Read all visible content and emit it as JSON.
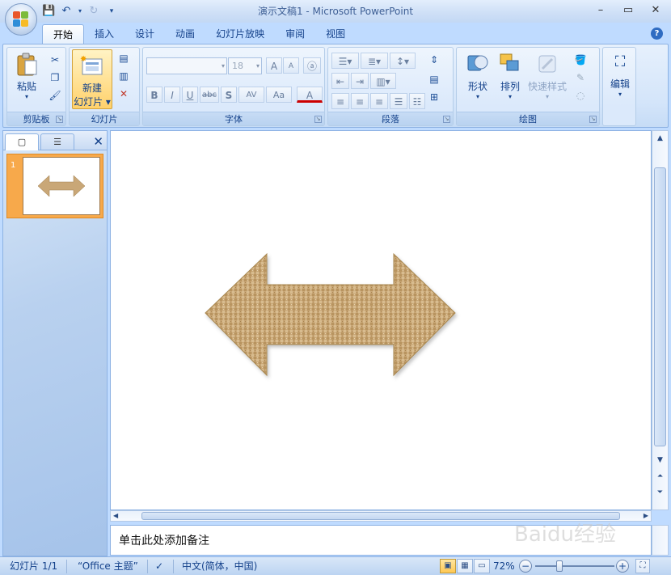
{
  "window": {
    "title": "演示文稿1 - Microsoft PowerPoint",
    "minimize": "–",
    "restore": "▭",
    "close": "✕"
  },
  "quick_access": {
    "save_icon": "save-icon",
    "undo_icon": "undo-icon",
    "redo_icon": "redo-icon",
    "customize_icon": "customize-icon"
  },
  "tabs": [
    {
      "label": "开始",
      "active": true
    },
    {
      "label": "插入"
    },
    {
      "label": "设计"
    },
    {
      "label": "动画"
    },
    {
      "label": "幻灯片放映"
    },
    {
      "label": "审阅"
    },
    {
      "label": "视图"
    }
  ],
  "ribbon": {
    "clipboard": {
      "label": "剪贴板",
      "paste": "粘贴"
    },
    "slides": {
      "label": "幻灯片",
      "new_slide_line1": "新建",
      "new_slide_line2": "幻灯片"
    },
    "font": {
      "label": "字体",
      "font_name": "",
      "font_size": "18",
      "bold": "B",
      "italic": "I",
      "underline": "U",
      "strike": "abc",
      "shadow": "S",
      "spacing": "AV",
      "case": "Aa",
      "color": "A",
      "grow": "A",
      "shrink": "A"
    },
    "paragraph": {
      "label": "段落"
    },
    "drawing": {
      "label": "绘图",
      "shapes": "形状",
      "arrange": "排列",
      "quick_styles": "快速样式"
    },
    "editing": {
      "label": "编辑"
    }
  },
  "slides_pane": {
    "slide_number": "1"
  },
  "notes_placeholder": "单击此处添加备注",
  "statusbar": {
    "slide_info": "幻灯片 1/1",
    "theme": "“Office 主题”",
    "language": "中文(简体，中国)",
    "zoom": "72%"
  },
  "zoom_level_percent": 72,
  "colors": {
    "accent": "#15428b",
    "arrow_fill": "#c9a777",
    "thumb_selected": "#f7a94b"
  },
  "watermark": "Baidu经验"
}
